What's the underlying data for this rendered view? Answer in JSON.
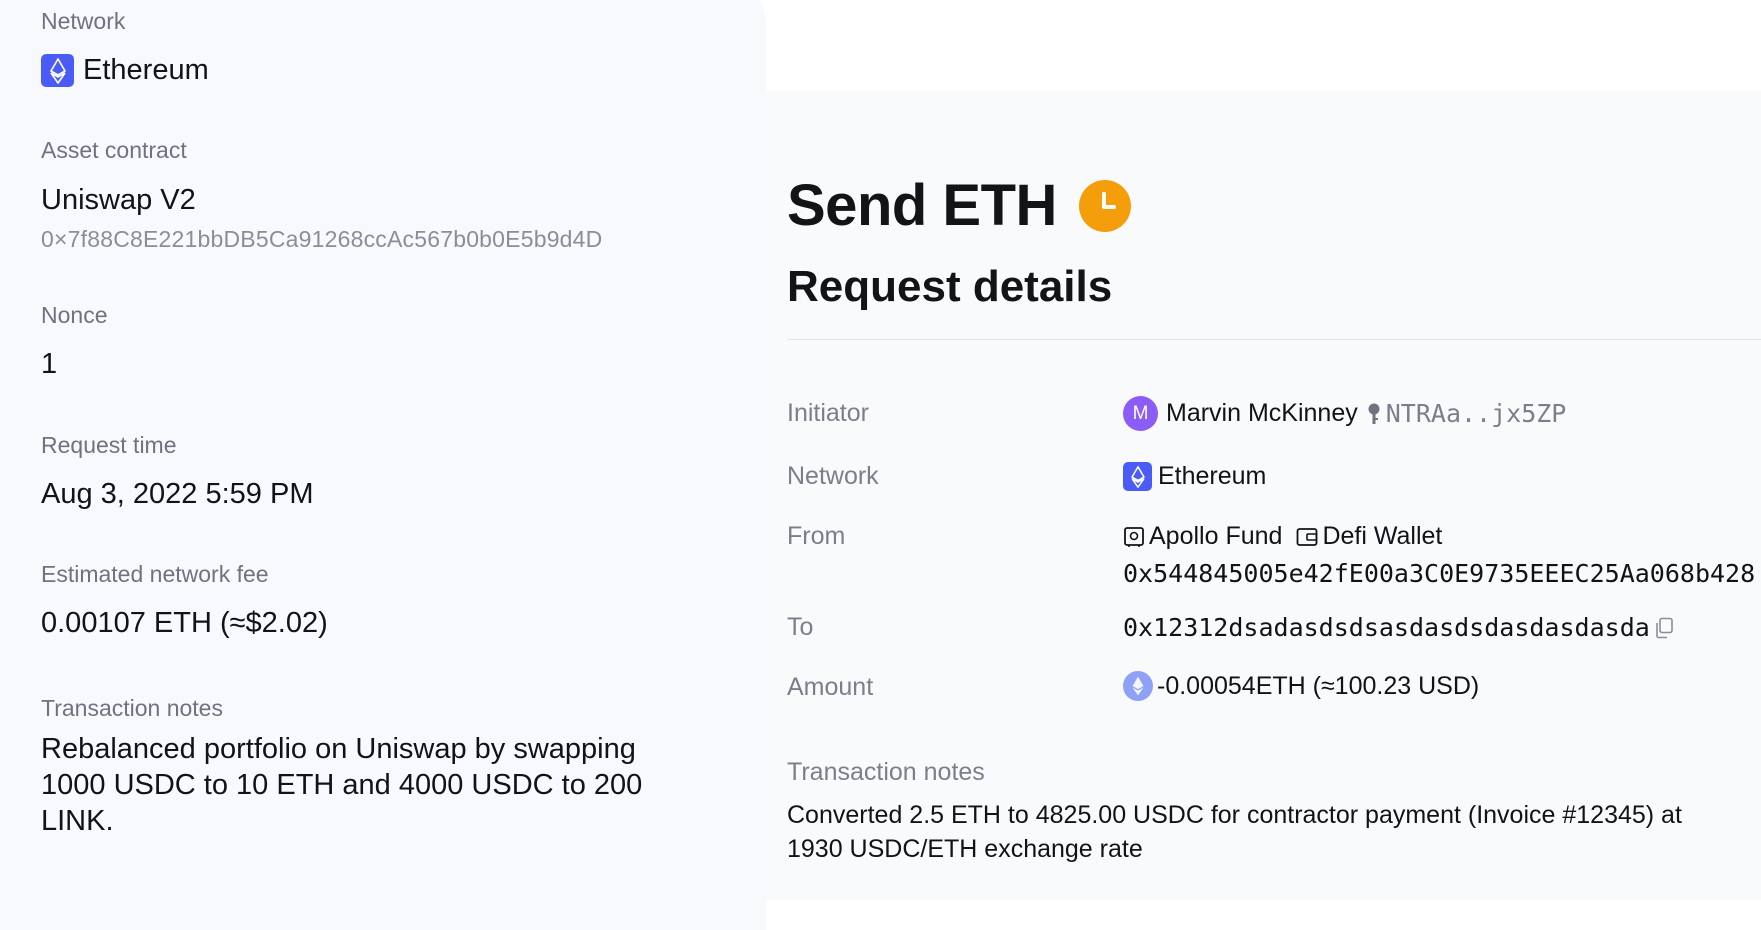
{
  "left": {
    "network": {
      "label": "Network",
      "value": "Ethereum",
      "icon": "ethereum-icon"
    },
    "asset_contract": {
      "label": "Asset contract",
      "name": "Uniswap V2",
      "address": "0×7f88C8E221bbDB5Ca91268ccAc567b0b0E5b9d4D"
    },
    "nonce": {
      "label": "Nonce",
      "value": "1"
    },
    "request_time": {
      "label": "Request time",
      "value": "Aug 3, 2022 5:59 PM"
    },
    "fee": {
      "label": "Estimated network fee",
      "value": "0.00107 ETH (≈$2.02)"
    },
    "notes": {
      "label": "Transaction notes",
      "value": "Rebalanced portfolio on Uniswap by swapping 1000 USDC to 10 ETH and 4000 USDC to 200 LINK."
    }
  },
  "right": {
    "title": "Send ETH",
    "status_icon": "clock-icon",
    "subtitle": "Request details",
    "initiator": {
      "label": "Initiator",
      "avatar": "M",
      "name": "Marvin McKinney",
      "key": "NTRAa..jx5ZP",
      "key_icon": "key-icon"
    },
    "network": {
      "label": "Network",
      "value": "Ethereum",
      "icon": "ethereum-icon"
    },
    "from": {
      "label": "From",
      "vault": "Apollo Fund",
      "vault_icon": "vault-icon",
      "wallet": "Defi Wallet",
      "wallet_icon": "wallet-icon",
      "address": "0x544845005e42fE00a3C0E9735EEEC25Aa068b428"
    },
    "to": {
      "label": "To",
      "address": "0x12312dsadasdsdsasdasdsdasdasdasda",
      "copy_icon": "copy-icon"
    },
    "amount": {
      "label": "Amount",
      "value": "-0.00054ETH (≈100.23 USD)",
      "icon": "ethereum-icon"
    },
    "notes": {
      "label": "Transaction notes",
      "value": "Converted 2.5 ETH to 4825.00 USDC for contractor payment (Invoice #12345) at 1930 USDC/ETH exchange rate"
    }
  },
  "colors": {
    "accent": "#4a5cf5",
    "pending": "#f59e0b",
    "avatar": "#8b5cf6"
  }
}
